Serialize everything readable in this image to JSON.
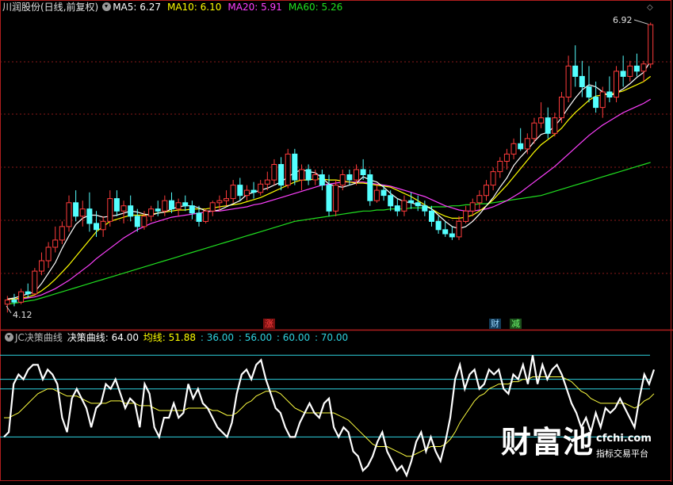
{
  "header": {
    "stock_title": "川润股份(日线,前复权)",
    "ma_items": [
      {
        "label": "MA5: 6.27",
        "color": "#ffffff"
      },
      {
        "label": "MA10: 6.10",
        "color": "#ffff00"
      },
      {
        "label": "MA20: 5.91",
        "color": "#ff40ff"
      },
      {
        "label": "MA60: 5.26",
        "color": "#20e020"
      }
    ]
  },
  "price_panel": {
    "high_label": "6.92",
    "low_label": "4.12",
    "ymin": 4.0,
    "ymax": 7.0,
    "event_badges": [
      {
        "text": "涨",
        "color": "#ff4040",
        "bg": "#7a1010"
      },
      {
        "text": "财",
        "color": "#9ad8ff",
        "bg": "#123c5a"
      },
      {
        "text": "减",
        "color": "#70ff70",
        "bg": "#1b4f1b"
      }
    ]
  },
  "indicator_panel": {
    "name": "JC决策曲线",
    "main_label": "决策曲线: 64.00",
    "avg_label": "均线: 51.88",
    "levels_text": [
      ": 36.00",
      ": 56.00",
      ": 60.00",
      ": 70.00"
    ],
    "levels": [
      36,
      56,
      60,
      70
    ],
    "ymin": 18,
    "ymax": 76
  },
  "watermark": {
    "brand": "财富池",
    "site": "cfchi.com",
    "tagline": "指标交易平台"
  },
  "colors": {
    "up": "#ff3b3b",
    "down": "#54ffff",
    "grid": "#8b1a1a",
    "level": "#2fd3e0",
    "frame": "#b01e1e"
  },
  "chart_data": [
    {
      "type": "candlestick",
      "title": "川润股份(日线,前复权)",
      "ylim": [
        4.0,
        7.0
      ],
      "grid": true,
      "candles": [
        [
          4.2,
          4.28,
          4.12,
          4.24
        ],
        [
          4.24,
          4.3,
          4.18,
          4.22
        ],
        [
          4.22,
          4.35,
          4.2,
          4.32
        ],
        [
          4.32,
          4.4,
          4.26,
          4.3
        ],
        [
          4.3,
          4.55,
          4.28,
          4.52
        ],
        [
          4.52,
          4.7,
          4.48,
          4.62
        ],
        [
          4.62,
          4.8,
          4.55,
          4.75
        ],
        [
          4.75,
          4.95,
          4.7,
          4.82
        ],
        [
          4.82,
          5.0,
          4.78,
          4.95
        ],
        [
          4.95,
          5.25,
          4.9,
          5.18
        ],
        [
          5.18,
          5.3,
          5.0,
          5.05
        ],
        [
          5.05,
          5.2,
          4.95,
          5.12
        ],
        [
          5.12,
          5.28,
          4.9,
          4.98
        ],
        [
          4.98,
          5.1,
          4.85,
          4.92
        ],
        [
          4.92,
          5.05,
          4.85,
          5.0
        ],
        [
          5.0,
          5.3,
          4.95,
          5.22
        ],
        [
          5.22,
          5.3,
          5.05,
          5.1
        ],
        [
          5.1,
          5.2,
          4.98,
          5.15
        ],
        [
          5.15,
          5.25,
          5.0,
          5.05
        ],
        [
          5.05,
          5.12,
          4.9,
          4.95
        ],
        [
          4.95,
          5.1,
          4.92,
          5.05
        ],
        [
          5.05,
          5.15,
          5.0,
          5.12
        ],
        [
          5.12,
          5.2,
          5.05,
          5.1
        ],
        [
          5.1,
          5.25,
          5.05,
          5.2
        ],
        [
          5.2,
          5.28,
          5.08,
          5.12
        ],
        [
          5.12,
          5.22,
          5.05,
          5.18
        ],
        [
          5.18,
          5.25,
          5.1,
          5.15
        ],
        [
          5.15,
          5.2,
          5.02,
          5.08
        ],
        [
          5.08,
          5.15,
          4.95,
          5.0
        ],
        [
          5.0,
          5.12,
          4.98,
          5.1
        ],
        [
          5.1,
          5.2,
          5.05,
          5.18
        ],
        [
          5.18,
          5.25,
          5.1,
          5.2
        ],
        [
          5.2,
          5.3,
          5.15,
          5.22
        ],
        [
          5.22,
          5.4,
          5.18,
          5.35
        ],
        [
          5.35,
          5.42,
          5.2,
          5.25
        ],
        [
          5.25,
          5.35,
          5.2,
          5.3
        ],
        [
          5.3,
          5.38,
          5.22,
          5.28
        ],
        [
          5.28,
          5.4,
          5.25,
          5.36
        ],
        [
          5.36,
          5.48,
          5.3,
          5.4
        ],
        [
          5.4,
          5.6,
          5.35,
          5.55
        ],
        [
          5.55,
          5.62,
          5.3,
          5.35
        ],
        [
          5.35,
          5.7,
          5.32,
          5.65
        ],
        [
          5.65,
          5.7,
          5.35,
          5.4
        ],
        [
          5.4,
          5.55,
          5.3,
          5.5
        ],
        [
          5.5,
          5.55,
          5.35,
          5.4
        ],
        [
          5.4,
          5.5,
          5.35,
          5.45
        ],
        [
          5.45,
          5.5,
          5.3,
          5.35
        ],
        [
          5.35,
          5.45,
          5.05,
          5.1
        ],
        [
          5.1,
          5.4,
          5.05,
          5.35
        ],
        [
          5.35,
          5.5,
          5.3,
          5.45
        ],
        [
          5.45,
          5.5,
          5.35,
          5.4
        ],
        [
          5.4,
          5.55,
          5.35,
          5.5
        ],
        [
          5.5,
          5.6,
          5.4,
          5.45
        ],
        [
          5.45,
          5.5,
          5.15,
          5.2
        ],
        [
          5.2,
          5.35,
          5.18,
          5.3
        ],
        [
          5.3,
          5.35,
          5.2,
          5.25
        ],
        [
          5.25,
          5.3,
          5.1,
          5.15
        ],
        [
          5.15,
          5.22,
          5.05,
          5.1
        ],
        [
          5.1,
          5.25,
          5.05,
          5.2
        ],
        [
          5.2,
          5.28,
          5.12,
          5.18
        ],
        [
          5.18,
          5.25,
          5.1,
          5.15
        ],
        [
          5.15,
          5.2,
          5.05,
          5.1
        ],
        [
          5.1,
          5.15,
          4.95,
          5.0
        ],
        [
          5.0,
          5.05,
          4.88,
          4.92
        ],
        [
          4.92,
          5.0,
          4.85,
          4.88
        ],
        [
          4.88,
          4.95,
          4.82,
          4.85
        ],
        [
          4.85,
          5.05,
          4.82,
          5.0
        ],
        [
          5.0,
          5.15,
          4.98,
          5.1
        ],
        [
          5.1,
          5.22,
          5.05,
          5.18
        ],
        [
          5.18,
          5.3,
          5.12,
          5.25
        ],
        [
          5.25,
          5.4,
          5.2,
          5.35
        ],
        [
          5.35,
          5.52,
          5.3,
          5.48
        ],
        [
          5.48,
          5.62,
          5.42,
          5.58
        ],
        [
          5.58,
          5.7,
          5.5,
          5.65
        ],
        [
          5.65,
          5.8,
          5.6,
          5.75
        ],
        [
          5.75,
          5.9,
          5.68,
          5.7
        ],
        [
          5.7,
          5.85,
          5.65,
          5.8
        ],
        [
          5.8,
          6.0,
          5.75,
          5.95
        ],
        [
          5.95,
          6.15,
          5.9,
          6.0
        ],
        [
          6.0,
          6.1,
          5.8,
          5.85
        ],
        [
          5.85,
          6.05,
          5.82,
          6.0
        ],
        [
          6.0,
          6.25,
          5.95,
          6.2
        ],
        [
          6.2,
          6.6,
          6.15,
          6.5
        ],
        [
          6.5,
          6.7,
          6.3,
          6.4
        ],
        [
          6.4,
          6.55,
          6.2,
          6.3
        ],
        [
          6.3,
          6.5,
          6.15,
          6.2
        ],
        [
          6.2,
          6.35,
          6.05,
          6.1
        ],
        [
          6.1,
          6.3,
          6.0,
          6.25
        ],
        [
          6.25,
          6.4,
          6.15,
          6.2
        ],
        [
          6.2,
          6.5,
          6.15,
          6.45
        ],
        [
          6.45,
          6.6,
          6.3,
          6.4
        ],
        [
          6.4,
          6.55,
          6.35,
          6.5
        ],
        [
          6.5,
          6.62,
          6.4,
          6.45
        ],
        [
          6.45,
          6.55,
          6.35,
          6.52
        ],
        [
          6.52,
          6.92,
          6.48,
          6.9
        ]
      ],
      "ma5": [
        4.25,
        4.26,
        4.28,
        4.3,
        4.32,
        4.4,
        4.5,
        4.6,
        4.74,
        4.86,
        4.97,
        5.03,
        5.06,
        5.06,
        5.04,
        5.05,
        5.06,
        5.08,
        5.1,
        5.09,
        5.07,
        5.06,
        5.08,
        5.09,
        5.12,
        5.14,
        5.15,
        5.15,
        5.13,
        5.1,
        5.1,
        5.11,
        5.14,
        5.17,
        5.2,
        5.26,
        5.28,
        5.3,
        5.32,
        5.35,
        5.38,
        5.43,
        5.47,
        5.5,
        5.48,
        5.47,
        5.42,
        5.36,
        5.34,
        5.33,
        5.35,
        5.37,
        5.43,
        5.4,
        5.38,
        5.33,
        5.27,
        5.22,
        5.19,
        5.18,
        5.16,
        5.15,
        5.12,
        5.06,
        5.0,
        4.95,
        4.93,
        4.95,
        5.0,
        5.07,
        5.15,
        5.23,
        5.33,
        5.42,
        5.54,
        5.62,
        5.69,
        5.77,
        5.84,
        5.86,
        5.92,
        6.0,
        6.1,
        6.19,
        6.27,
        6.32,
        6.3,
        6.25,
        6.21,
        6.24,
        6.28,
        6.33,
        6.39,
        6.44,
        6.55
      ],
      "ma10": [
        4.25,
        4.25,
        4.26,
        4.27,
        4.29,
        4.33,
        4.38,
        4.44,
        4.51,
        4.58,
        4.66,
        4.74,
        4.82,
        4.9,
        4.95,
        5.0,
        5.02,
        5.04,
        5.06,
        5.06,
        5.06,
        5.07,
        5.08,
        5.09,
        5.1,
        5.11,
        5.11,
        5.12,
        5.12,
        5.12,
        5.13,
        5.14,
        5.15,
        5.16,
        5.17,
        5.19,
        5.21,
        5.23,
        5.26,
        5.29,
        5.32,
        5.35,
        5.38,
        5.4,
        5.4,
        5.41,
        5.41,
        5.4,
        5.4,
        5.39,
        5.38,
        5.37,
        5.37,
        5.36,
        5.35,
        5.34,
        5.33,
        5.3,
        5.27,
        5.24,
        5.2,
        5.16,
        5.12,
        5.08,
        5.05,
        5.03,
        5.03,
        5.04,
        5.06,
        5.1,
        5.15,
        5.21,
        5.28,
        5.35,
        5.43,
        5.51,
        5.59,
        5.67,
        5.74,
        5.79,
        5.84,
        5.9,
        5.98,
        6.05,
        6.11,
        6.17,
        6.21,
        6.22,
        6.23,
        6.24,
        6.26,
        6.29,
        6.32,
        6.35,
        6.4
      ],
      "ma20": [
        4.25,
        4.25,
        4.25,
        4.26,
        4.27,
        4.29,
        4.32,
        4.35,
        4.39,
        4.43,
        4.48,
        4.53,
        4.58,
        4.64,
        4.69,
        4.74,
        4.79,
        4.84,
        4.88,
        4.92,
        4.95,
        4.98,
        5.0,
        5.02,
        5.04,
        5.05,
        5.06,
        5.07,
        5.08,
        5.09,
        5.1,
        5.1,
        5.11,
        5.12,
        5.13,
        5.14,
        5.16,
        5.17,
        5.19,
        5.21,
        5.23,
        5.25,
        5.27,
        5.29,
        5.31,
        5.33,
        5.35,
        5.36,
        5.37,
        5.38,
        5.38,
        5.38,
        5.38,
        5.37,
        5.36,
        5.35,
        5.34,
        5.32,
        5.3,
        5.28,
        5.26,
        5.24,
        5.21,
        5.18,
        5.15,
        5.13,
        5.11,
        5.1,
        5.1,
        5.11,
        5.12,
        5.14,
        5.17,
        5.2,
        5.24,
        5.28,
        5.33,
        5.38,
        5.43,
        5.48,
        5.53,
        5.59,
        5.65,
        5.71,
        5.77,
        5.83,
        5.88,
        5.93,
        5.97,
        6.01,
        6.05,
        6.08,
        6.11,
        6.14,
        6.18
      ],
      "ma60": [
        4.2,
        4.21,
        4.22,
        4.23,
        4.24,
        4.26,
        4.28,
        4.3,
        4.32,
        4.34,
        4.36,
        4.38,
        4.4,
        4.42,
        4.44,
        4.46,
        4.48,
        4.5,
        4.52,
        4.54,
        4.56,
        4.58,
        4.6,
        4.62,
        4.64,
        4.66,
        4.68,
        4.7,
        4.72,
        4.74,
        4.76,
        4.78,
        4.8,
        4.82,
        4.84,
        4.86,
        4.88,
        4.9,
        4.92,
        4.94,
        4.96,
        4.98,
        5.0,
        5.01,
        5.02,
        5.03,
        5.04,
        5.05,
        5.06,
        5.07,
        5.08,
        5.09,
        5.1,
        5.1,
        5.11,
        5.11,
        5.12,
        5.12,
        5.12,
        5.13,
        5.13,
        5.13,
        5.14,
        5.14,
        5.14,
        5.15,
        5.15,
        5.16,
        5.16,
        5.17,
        5.17,
        5.18,
        5.19,
        5.2,
        5.21,
        5.22,
        5.23,
        5.24,
        5.25,
        5.27,
        5.29,
        5.31,
        5.33,
        5.35,
        5.37,
        5.39,
        5.41,
        5.43,
        5.45,
        5.47,
        5.49,
        5.51,
        5.53,
        5.55,
        5.57
      ]
    },
    {
      "type": "line",
      "title": "JC决策曲线",
      "ylim": [
        18,
        76
      ],
      "reference_levels": [
        36,
        56,
        60,
        70
      ],
      "series": [
        {
          "name": "决策曲线",
          "values": [
            36,
            38,
            58,
            62,
            60,
            64,
            66,
            66,
            60,
            64,
            62,
            58,
            44,
            38,
            52,
            56,
            52,
            48,
            40,
            48,
            50,
            58,
            56,
            60,
            54,
            48,
            52,
            50,
            40,
            58,
            54,
            40,
            36,
            44,
            44,
            50,
            44,
            46,
            58,
            52,
            56,
            50,
            48,
            44,
            40,
            38,
            36,
            42,
            54,
            62,
            64,
            60,
            66,
            68,
            60,
            54,
            48,
            46,
            40,
            36,
            36,
            42,
            46,
            50,
            46,
            44,
            50,
            52,
            40,
            36,
            40,
            38,
            30,
            28,
            22,
            24,
            28,
            34,
            38,
            30,
            26,
            22,
            24,
            20,
            26,
            34,
            38,
            30,
            36,
            30,
            26,
            34,
            44,
            60,
            66,
            56,
            62,
            64,
            56,
            58,
            64,
            62,
            64,
            56,
            54,
            62,
            60,
            66,
            58,
            70,
            58,
            66,
            60,
            64,
            66,
            62,
            56,
            50,
            46,
            40,
            44,
            38,
            46,
            40,
            48,
            46,
            48,
            52,
            48,
            44,
            40,
            52,
            62,
            58,
            64
          ]
        },
        {
          "name": "均线",
          "values": [
            44,
            44,
            45,
            46,
            48,
            50,
            52,
            54,
            55,
            56,
            56,
            55,
            54,
            53,
            53,
            53,
            52,
            51,
            50,
            50,
            50,
            50,
            51,
            51,
            51,
            50,
            50,
            50,
            49,
            49,
            49,
            48,
            47,
            47,
            47,
            47,
            47,
            47,
            48,
            48,
            48,
            48,
            48,
            47,
            47,
            46,
            45,
            45,
            46,
            48,
            50,
            51,
            53,
            54,
            55,
            55,
            55,
            54,
            52,
            50,
            48,
            47,
            46,
            46,
            46,
            46,
            46,
            46,
            46,
            45,
            44,
            43,
            41,
            39,
            37,
            35,
            33,
            32,
            32,
            32,
            31,
            30,
            29,
            28,
            28,
            29,
            30,
            31,
            32,
            32,
            32,
            33,
            35,
            38,
            42,
            45,
            48,
            51,
            53,
            54,
            56,
            57,
            58,
            58,
            58,
            59,
            59,
            60,
            60,
            61,
            61,
            61,
            61,
            61,
            61,
            61,
            60,
            59,
            57,
            55,
            54,
            52,
            51,
            50,
            50,
            50,
            50,
            50,
            50,
            49,
            48,
            49,
            51,
            52,
            54
          ]
        }
      ]
    }
  ]
}
